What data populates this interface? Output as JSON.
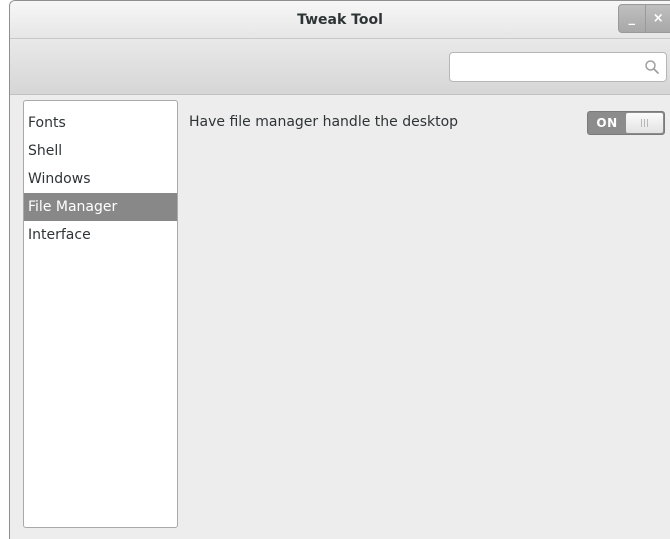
{
  "window": {
    "title": "Tweak Tool",
    "minimize_label": "_",
    "close_label": "×"
  },
  "search": {
    "value": "",
    "placeholder": ""
  },
  "sidebar": {
    "items": [
      {
        "label": "Fonts",
        "selected": false
      },
      {
        "label": "Shell",
        "selected": false
      },
      {
        "label": "Windows",
        "selected": false
      },
      {
        "label": "File Manager",
        "selected": true
      },
      {
        "label": "Interface",
        "selected": false
      }
    ]
  },
  "main": {
    "settings": [
      {
        "label": "Have file manager handle the desktop",
        "switch_label": "ON",
        "enabled": true
      }
    ]
  },
  "colors": {
    "selected_bg": "#888888",
    "window_bg": "#ededed"
  }
}
